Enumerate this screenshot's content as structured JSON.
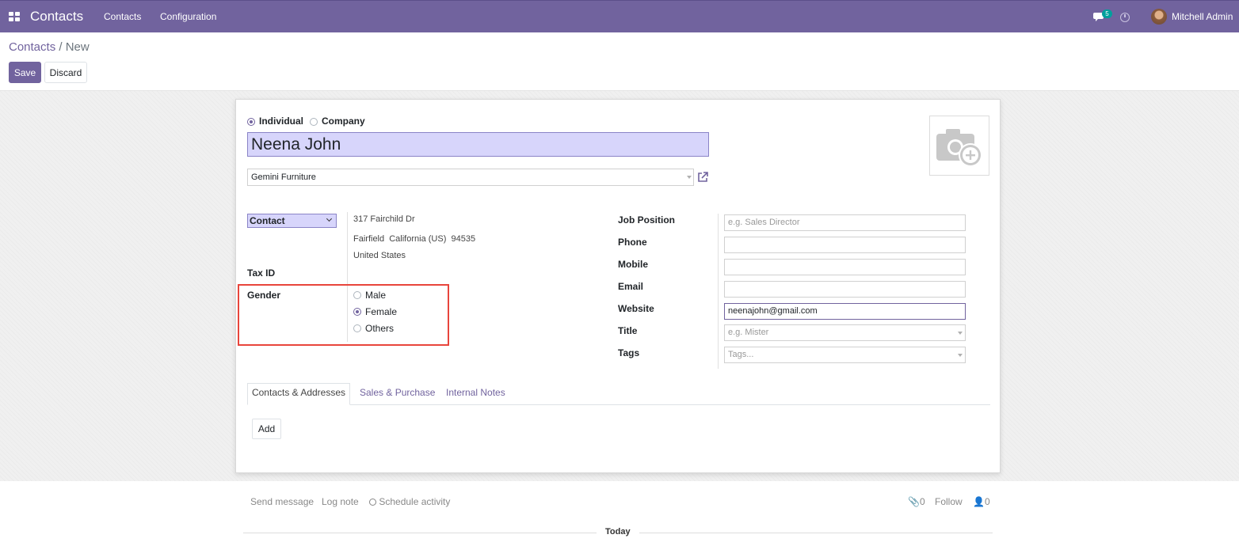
{
  "navbar": {
    "app_name": "Contacts",
    "menu": [
      "Contacts",
      "Configuration"
    ],
    "messages_badge": "5",
    "user_name": "Mitchell Admin"
  },
  "breadcrumb": {
    "parent": "Contacts",
    "separator": "/",
    "current": "New"
  },
  "buttons": {
    "save": "Save",
    "discard": "Discard"
  },
  "form": {
    "type_options": [
      {
        "label": "Individual",
        "checked": true
      },
      {
        "label": "Company",
        "checked": false
      }
    ],
    "name": "Neena John",
    "company": "Gemini Furniture",
    "address_type": "Contact",
    "address": {
      "street": "317 Fairchild Dr",
      "city_line": "Fairfield  California (US)  94535",
      "country": "United States"
    },
    "tax_id_label": "Tax ID",
    "gender": {
      "label": "Gender",
      "options": [
        {
          "label": "Male",
          "checked": false
        },
        {
          "label": "Female",
          "checked": true
        },
        {
          "label": "Others",
          "checked": false
        }
      ]
    },
    "right_fields": {
      "job_position": {
        "label": "Job Position",
        "placeholder": "e.g. Sales Director",
        "value": ""
      },
      "phone": {
        "label": "Phone",
        "value": ""
      },
      "mobile": {
        "label": "Mobile",
        "value": ""
      },
      "email": {
        "label": "Email",
        "value": ""
      },
      "website": {
        "label": "Website",
        "value": "neenajohn@gmail.com"
      },
      "title": {
        "label": "Title",
        "placeholder": "e.g. Mister"
      },
      "tags": {
        "label": "Tags",
        "placeholder": "Tags..."
      }
    },
    "tabs": [
      "Contacts & Addresses",
      "Sales & Purchase",
      "Internal Notes"
    ],
    "add_button": "Add"
  },
  "chatter": {
    "send_message": "Send message",
    "log_note": "Log note",
    "schedule_activity": "Schedule activity",
    "attachments_count": "0",
    "follow": "Follow",
    "followers_count": "0",
    "today": "Today"
  },
  "colors": {
    "primary": "#71639e",
    "highlight": "#e8453c",
    "input_required_bg": "#d7d5fb"
  }
}
